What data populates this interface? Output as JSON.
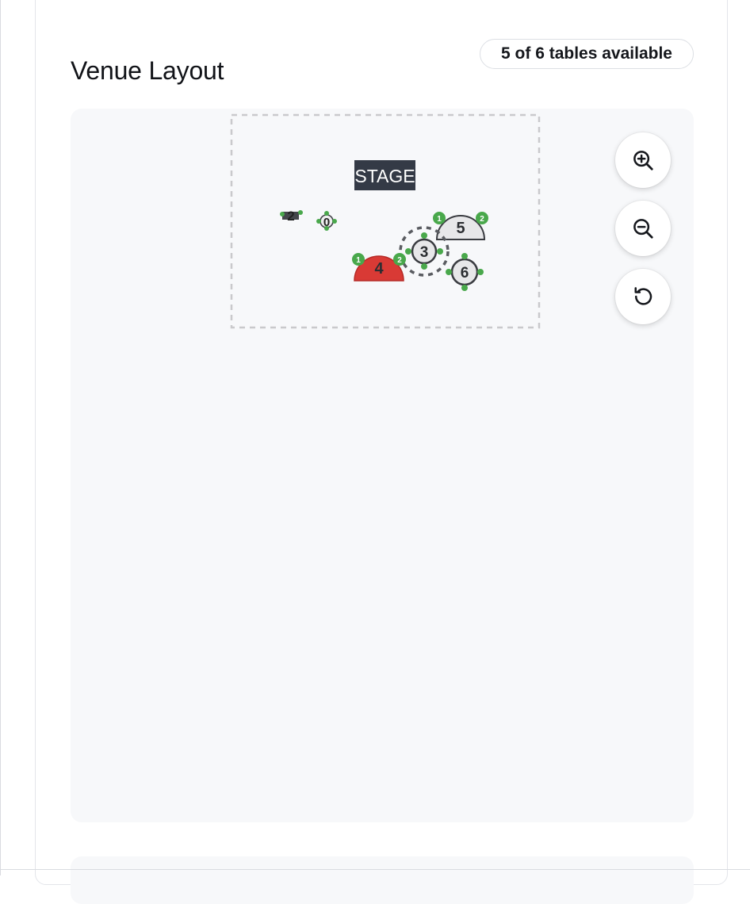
{
  "header": {
    "title": "Venue Layout",
    "availability": "5 of 6 tables available"
  },
  "floor": {
    "stage_label": "STAGE",
    "tables": [
      {
        "number": "2",
        "shape": "rect-small",
        "status": "available"
      },
      {
        "number": "0",
        "shape": "round-small",
        "status": "available"
      },
      {
        "number": "3",
        "shape": "round",
        "status": "selected"
      },
      {
        "number": "4",
        "shape": "half-round",
        "status": "reserved"
      },
      {
        "number": "5",
        "shape": "half-round",
        "status": "available"
      },
      {
        "number": "6",
        "shape": "round",
        "status": "available"
      }
    ],
    "seat_labels": {
      "one": "1",
      "two": "2"
    }
  },
  "controls": {
    "zoom_in_icon": "zoom-in-icon",
    "zoom_out_icon": "zoom-out-icon",
    "reset_icon": "reset-view-icon"
  },
  "colors": {
    "reserved": "#d93a35",
    "available": "#e7e7e9",
    "seat": "#49a84b",
    "stage": "#343a46"
  }
}
